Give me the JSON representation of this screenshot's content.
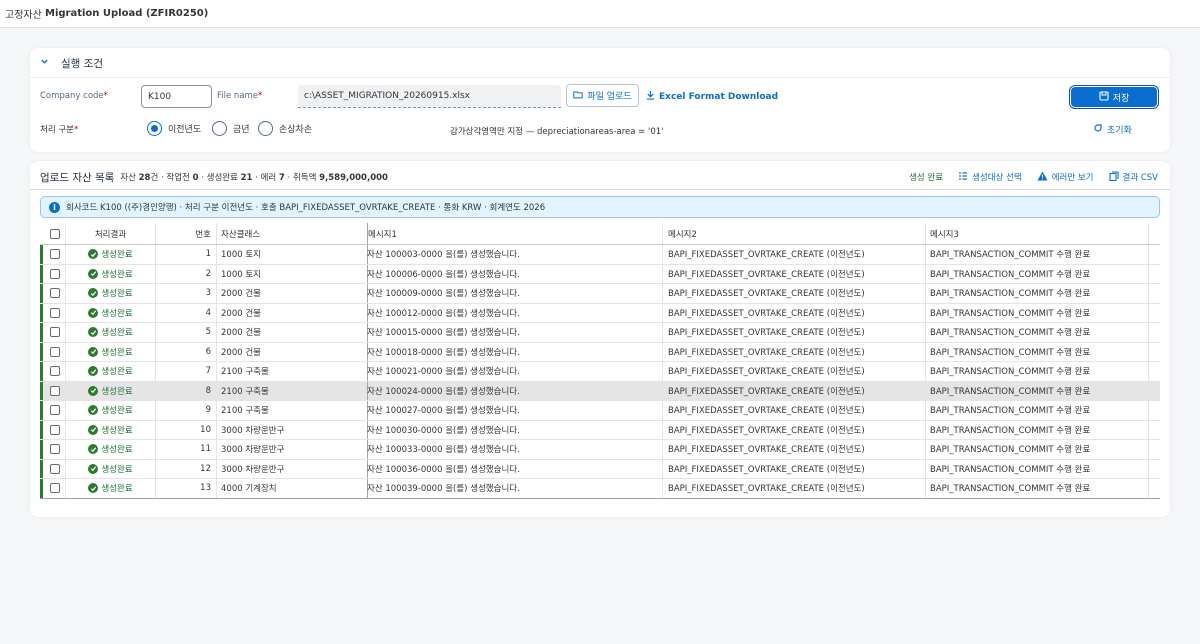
{
  "app": {
    "title_prefix": "고정자산",
    "title_main": "Migration Upload (ZFIR0250)"
  },
  "condition": {
    "section_title": "실행 조건",
    "company_code_label": "Company code",
    "company_code_value": "K100",
    "file_name_label": "File name",
    "file_name_value": "c:\\ASSET_MIGRATION_20260915.xlsx",
    "upload_button": "파일 업로드",
    "excel_link": "Excel Format Download",
    "save_button": "저장",
    "process_label": "처리 구분",
    "radio_options": [
      {
        "label": "이전년도",
        "selected": true
      },
      {
        "label": "금년",
        "selected": false
      },
      {
        "label": "손상차손",
        "selected": false
      }
    ],
    "depr_note": "감가상각영역만 지정 — depreciationareas-area = '01'",
    "reset_link": "초기화"
  },
  "list": {
    "title": "업로드 자산 목록",
    "stats": [
      {
        "label": "자산",
        "value": "28",
        "unit": "건"
      },
      {
        "label": "작업전",
        "value": "0",
        "unit": ""
      },
      {
        "label": "생성완료",
        "value": "21",
        "unit": ""
      },
      {
        "label": "에러",
        "value": "7",
        "unit": ""
      },
      {
        "label": "취득액",
        "value": "9,589,000,000",
        "unit": ""
      }
    ],
    "tools": {
      "generated": "생성 완료",
      "select_target": "생성대상 선택",
      "errors_only": "에러만 보기",
      "result_csv": "결과 CSV"
    },
    "info_strip": "회사코드 K100 ((주)경인양행) · 처리 구분 이전년도 · 호출 BAPI_FIXEDASSET_OVRTAKE_CREATE · 통화 KRW · 회계연도 2026",
    "columns": {
      "result": "처리결과",
      "no": "번호",
      "asset_class": "자산클래스",
      "msg1": "메시지1",
      "msg2": "메시지2",
      "msg3": "메시지3"
    },
    "rows": [
      {
        "result": "생성완료",
        "no": "1",
        "asset_class": "1000 토지",
        "msg1": "자산 100003-0000 을(를) 생성했습니다.",
        "msg2": "BAPI_FIXEDASSET_OVRTAKE_CREATE (이전년도)",
        "msg3": "BAPI_TRANSACTION_COMMIT 수행 완료"
      },
      {
        "result": "생성완료",
        "no": "2",
        "asset_class": "1000 토지",
        "msg1": "자산 100006-0000 을(를) 생성했습니다.",
        "msg2": "BAPI_FIXEDASSET_OVRTAKE_CREATE (이전년도)",
        "msg3": "BAPI_TRANSACTION_COMMIT 수행 완료"
      },
      {
        "result": "생성완료",
        "no": "3",
        "asset_class": "2000 건물",
        "msg1": "자산 100009-0000 을(를) 생성했습니다.",
        "msg2": "BAPI_FIXEDASSET_OVRTAKE_CREATE (이전년도)",
        "msg3": "BAPI_TRANSACTION_COMMIT 수행 완료"
      },
      {
        "result": "생성완료",
        "no": "4",
        "asset_class": "2000 건물",
        "msg1": "자산 100012-0000 을(를) 생성했습니다.",
        "msg2": "BAPI_FIXEDASSET_OVRTAKE_CREATE (이전년도)",
        "msg3": "BAPI_TRANSACTION_COMMIT 수행 완료"
      },
      {
        "result": "생성완료",
        "no": "5",
        "asset_class": "2000 건물",
        "msg1": "자산 100015-0000 을(를) 생성했습니다.",
        "msg2": "BAPI_FIXEDASSET_OVRTAKE_CREATE (이전년도)",
        "msg3": "BAPI_TRANSACTION_COMMIT 수행 완료"
      },
      {
        "result": "생성완료",
        "no": "6",
        "asset_class": "2000 건물",
        "msg1": "자산 100018-0000 을(를) 생성했습니다.",
        "msg2": "BAPI_FIXEDASSET_OVRTAKE_CREATE (이전년도)",
        "msg3": "BAPI_TRANSACTION_COMMIT 수행 완료"
      },
      {
        "result": "생성완료",
        "no": "7",
        "asset_class": "2100 구축물",
        "msg1": "자산 100021-0000 을(를) 생성했습니다.",
        "msg2": "BAPI_FIXEDASSET_OVRTAKE_CREATE (이전년도)",
        "msg3": "BAPI_TRANSACTION_COMMIT 수행 완료"
      },
      {
        "result": "생성완료",
        "no": "8",
        "asset_class": "2100 구축물",
        "msg1": "자산 100024-0000 을(를) 생성했습니다.",
        "msg2": "BAPI_FIXEDASSET_OVRTAKE_CREATE (이전년도)",
        "msg3": "BAPI_TRANSACTION_COMMIT 수행 완료"
      },
      {
        "result": "생성완료",
        "no": "9",
        "asset_class": "2100 구축물",
        "msg1": "자산 100027-0000 을(를) 생성했습니다.",
        "msg2": "BAPI_FIXEDASSET_OVRTAKE_CREATE (이전년도)",
        "msg3": "BAPI_TRANSACTION_COMMIT 수행 완료"
      },
      {
        "result": "생성완료",
        "no": "10",
        "asset_class": "3000 차량운반구",
        "msg1": "자산 100030-0000 을(를) 생성했습니다.",
        "msg2": "BAPI_FIXEDASSET_OVRTAKE_CREATE (이전년도)",
        "msg3": "BAPI_TRANSACTION_COMMIT 수행 완료"
      },
      {
        "result": "생성완료",
        "no": "11",
        "asset_class": "3000 차량운반구",
        "msg1": "자산 100033-0000 을(를) 생성했습니다.",
        "msg2": "BAPI_FIXEDASSET_OVRTAKE_CREATE (이전년도)",
        "msg3": "BAPI_TRANSACTION_COMMIT 수행 완료"
      },
      {
        "result": "생성완료",
        "no": "12",
        "asset_class": "3000 차량운반구",
        "msg1": "자산 100036-0000 을(를) 생성했습니다.",
        "msg2": "BAPI_FIXEDASSET_OVRTAKE_CREATE (이전년도)",
        "msg3": "BAPI_TRANSACTION_COMMIT 수행 완료"
      },
      {
        "result": "생성완료",
        "no": "13",
        "asset_class": "4000 기계장치",
        "msg1": "자산 100039-0000 을(를) 생성했습니다.",
        "msg2": "BAPI_FIXEDASSET_OVRTAKE_CREATE (이전년도)",
        "msg3": "BAPI_TRANSACTION_COMMIT 수행 완료"
      }
    ],
    "selected_row_index": 7
  },
  "colors": {
    "accent": "#0a6ed1",
    "success": "#256f3a",
    "required": "#bb0000",
    "info_bg": "#e1f4ff"
  },
  "icons": [
    "chevron-down-icon",
    "folder-icon",
    "download-icon",
    "save-icon",
    "reset-icon",
    "list-check-icon",
    "warning-icon",
    "copy-icon",
    "info-icon",
    "check-circle-icon"
  ]
}
